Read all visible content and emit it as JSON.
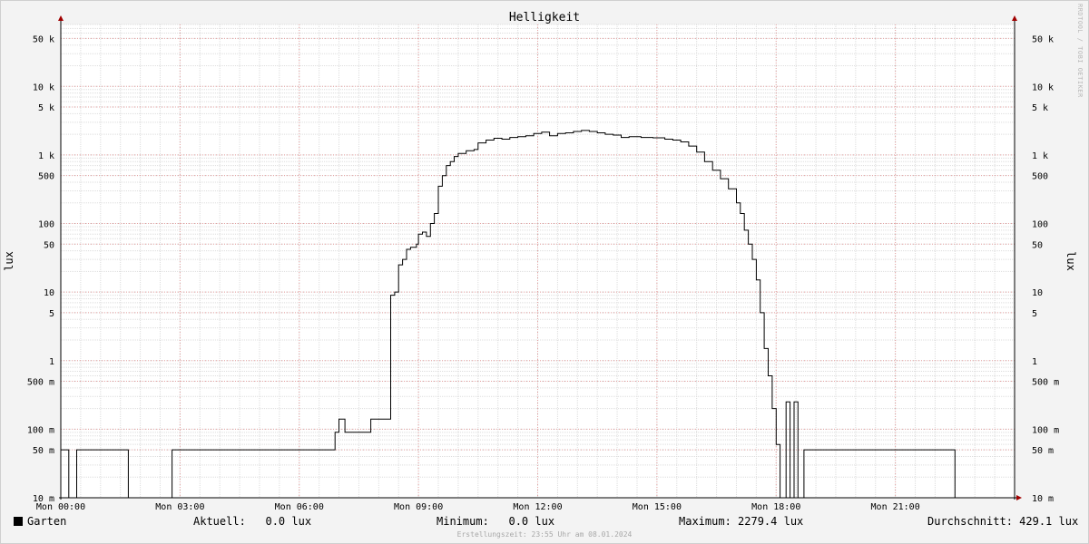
{
  "chart_data": {
    "type": "line",
    "title": "Helligkeit",
    "ylabel": "lux",
    "yscale": "log",
    "ylim": [
      0.01,
      80000
    ],
    "xlim_hours": [
      0,
      24
    ],
    "xticks": [
      "Mon 00:00",
      "Mon 03:00",
      "Mon 06:00",
      "Mon 09:00",
      "Mon 12:00",
      "Mon 15:00",
      "Mon 18:00",
      "Mon 21:00"
    ],
    "yticks": [
      {
        "value": 0.01,
        "label": "10 m"
      },
      {
        "value": 0.05,
        "label": "50 m"
      },
      {
        "value": 0.1,
        "label": "100 m"
      },
      {
        "value": 0.5,
        "label": "500 m"
      },
      {
        "value": 1,
        "label": "1"
      },
      {
        "value": 5,
        "label": "5"
      },
      {
        "value": 10,
        "label": "10"
      },
      {
        "value": 50,
        "label": "50"
      },
      {
        "value": 100,
        "label": "100"
      },
      {
        "value": 500,
        "label": "500"
      },
      {
        "value": 1000,
        "label": "1 k"
      },
      {
        "value": 5000,
        "label": "5 k"
      },
      {
        "value": 10000,
        "label": "10 k"
      },
      {
        "value": 50000,
        "label": "50 k"
      }
    ],
    "grid": true,
    "series": [
      {
        "name": "Garten",
        "color": "#000000",
        "points": [
          [
            0.0,
            0.05
          ],
          [
            0.2,
            0.05
          ],
          [
            0.2,
            0.01
          ],
          [
            0.4,
            0.01
          ],
          [
            0.4,
            0.05
          ],
          [
            1.7,
            0.05
          ],
          [
            1.7,
            0.01
          ],
          [
            2.8,
            0.01
          ],
          [
            2.8,
            0.05
          ],
          [
            6.9,
            0.05
          ],
          [
            6.9,
            0.09
          ],
          [
            7.0,
            0.09
          ],
          [
            7.0,
            0.14
          ],
          [
            7.1,
            0.14
          ],
          [
            7.15,
            0.09
          ],
          [
            7.75,
            0.09
          ],
          [
            7.8,
            0.14
          ],
          [
            8.3,
            0.14
          ],
          [
            8.3,
            9
          ],
          [
            8.4,
            10
          ],
          [
            8.5,
            25
          ],
          [
            8.6,
            30
          ],
          [
            8.7,
            42
          ],
          [
            8.8,
            45
          ],
          [
            8.95,
            50
          ],
          [
            9.0,
            70
          ],
          [
            9.1,
            75
          ],
          [
            9.2,
            65
          ],
          [
            9.3,
            100
          ],
          [
            9.4,
            140
          ],
          [
            9.5,
            350
          ],
          [
            9.6,
            500
          ],
          [
            9.7,
            700
          ],
          [
            9.8,
            800
          ],
          [
            9.9,
            950
          ],
          [
            10.0,
            1050
          ],
          [
            10.2,
            1150
          ],
          [
            10.4,
            1200
          ],
          [
            10.5,
            1500
          ],
          [
            10.7,
            1650
          ],
          [
            10.9,
            1750
          ],
          [
            11.1,
            1700
          ],
          [
            11.3,
            1800
          ],
          [
            11.5,
            1850
          ],
          [
            11.7,
            1900
          ],
          [
            11.9,
            2050
          ],
          [
            12.1,
            2150
          ],
          [
            12.3,
            1900
          ],
          [
            12.5,
            2050
          ],
          [
            12.7,
            2100
          ],
          [
            12.9,
            2200
          ],
          [
            13.1,
            2279.4
          ],
          [
            13.3,
            2200
          ],
          [
            13.5,
            2100
          ],
          [
            13.7,
            2000
          ],
          [
            13.9,
            1950
          ],
          [
            14.1,
            1800
          ],
          [
            14.3,
            1850
          ],
          [
            14.6,
            1800
          ],
          [
            14.9,
            1780
          ],
          [
            15.2,
            1700
          ],
          [
            15.4,
            1650
          ],
          [
            15.6,
            1550
          ],
          [
            15.8,
            1350
          ],
          [
            16.0,
            1100
          ],
          [
            16.2,
            800
          ],
          [
            16.4,
            600
          ],
          [
            16.6,
            450
          ],
          [
            16.8,
            320
          ],
          [
            17.0,
            200
          ],
          [
            17.1,
            140
          ],
          [
            17.2,
            80
          ],
          [
            17.3,
            50
          ],
          [
            17.4,
            30
          ],
          [
            17.5,
            15
          ],
          [
            17.6,
            5
          ],
          [
            17.7,
            1.5
          ],
          [
            17.8,
            0.6
          ],
          [
            17.9,
            0.2
          ],
          [
            18.0,
            0.06
          ],
          [
            18.1,
            0.05
          ],
          [
            18.1,
            0.01
          ],
          [
            18.25,
            0.01
          ],
          [
            18.25,
            0.25
          ],
          [
            18.35,
            0.25
          ],
          [
            18.35,
            0.01
          ],
          [
            18.45,
            0.01
          ],
          [
            18.45,
            0.25
          ],
          [
            18.55,
            0.25
          ],
          [
            18.55,
            0.01
          ],
          [
            18.7,
            0.01
          ],
          [
            18.7,
            0.05
          ],
          [
            22.5,
            0.05
          ],
          [
            22.5,
            0.01
          ],
          [
            24.0,
            0.01
          ]
        ]
      }
    ]
  },
  "legend": {
    "series_name": "Garten",
    "current_label": "Aktuell:",
    "current_value": "0.0 lux",
    "min_label": "Minimum:",
    "min_value": "0.0 lux",
    "max_label": "Maximum:",
    "max_value": "2279.4 lux",
    "avg_label": "Durchschnitt:",
    "avg_value": "429.1 lux"
  },
  "footer": "Erstellungszeit: 23:55 Uhr am 08.01.2024",
  "watermark": "RRDTOOL / TOBI OETIKER"
}
